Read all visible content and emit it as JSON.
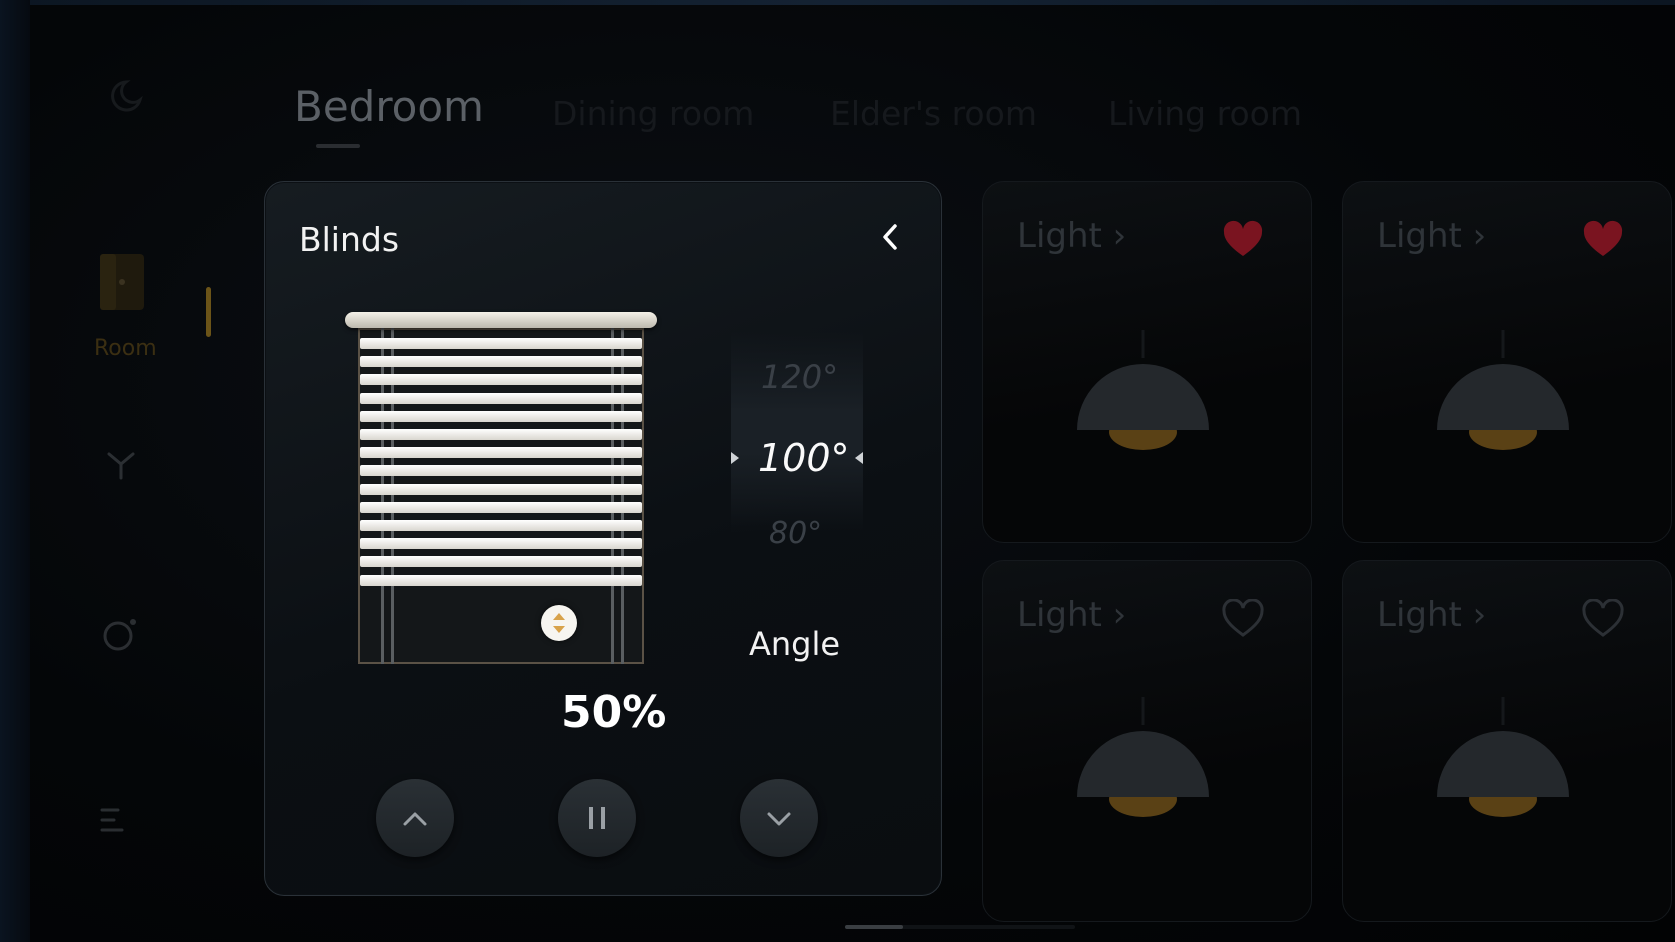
{
  "sidebar": {
    "room_label": "Room"
  },
  "tabs": [
    {
      "label": "Bedroom"
    },
    {
      "label": "Dining room"
    },
    {
      "label": "Elder's room"
    },
    {
      "label": "Living room"
    }
  ],
  "blinds_card": {
    "title": "Blinds",
    "position_label": "50%",
    "position_fraction": 0.5,
    "angle": {
      "previous": "120°",
      "current": "100°",
      "next": "80°",
      "label": "Angle"
    }
  },
  "light_cards": [
    {
      "title": "Light",
      "favorite": true
    },
    {
      "title": "Light",
      "favorite": true
    },
    {
      "title": "Light",
      "favorite": false
    },
    {
      "title": "Light",
      "favorite": false
    }
  ],
  "colors": {
    "accent_gold": "#d8a24a",
    "favorite_red": "#7a1420",
    "lamp_glow": "#8a6420"
  }
}
